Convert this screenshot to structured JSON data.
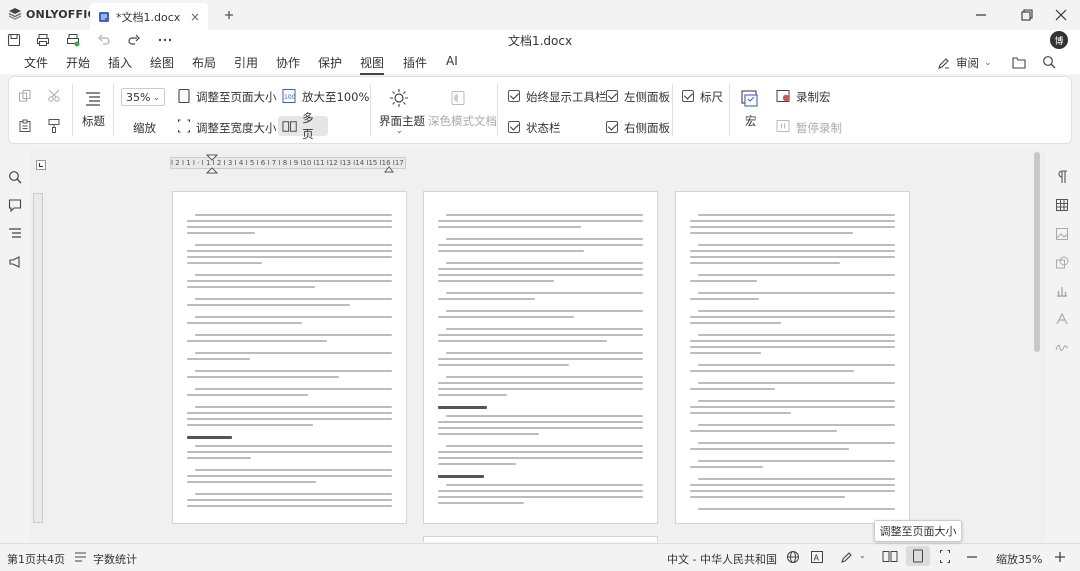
{
  "app": {
    "brand": "ONLYOFFICE",
    "tab_title": "*文档1.docx",
    "doc_title": "文档1.docx",
    "avatar": "博"
  },
  "menu": {
    "items": [
      "文件",
      "开始",
      "插入",
      "绘图",
      "布局",
      "引用",
      "协作",
      "保护",
      "视图",
      "插件",
      "AI"
    ],
    "active": "视图",
    "review": "审阅"
  },
  "ribbon": {
    "title_btn": "标题",
    "zoom_value": "35%",
    "zoom_label": "缩放",
    "fit_page": "调整至页面大小",
    "fit_width": "调整至宽度大小",
    "zoom_100": "放大至100%",
    "multi_page": "多页",
    "ui_theme": "界面主题",
    "dark_doc": "深色模式文档",
    "always_toolbar": "始终显示工具栏",
    "status_bar": "状态栏",
    "left_panel": "左侧面板",
    "right_panel": "右侧面板",
    "ruler": "标尺",
    "macro": "宏",
    "record_macro": "录制宏",
    "pause_record": "暂停录制"
  },
  "ruler_text": "I 2 I 1 I · I 1 I 2 I 3 I 4 I 5 I 6 I 7 I 8 I 9 I10 I11 I12 I13 I14 I15 I16 I17 I",
  "status": {
    "page_info": "第1页共4页",
    "word_count": "字数统计",
    "language": "中文 - 中华人民共和国",
    "zoom": "缩放35%",
    "tooltip": "调整至页面大小"
  },
  "colors": {
    "accent": "#3a7bd5",
    "record": "#d9534f",
    "link": "#2a6fd6"
  }
}
